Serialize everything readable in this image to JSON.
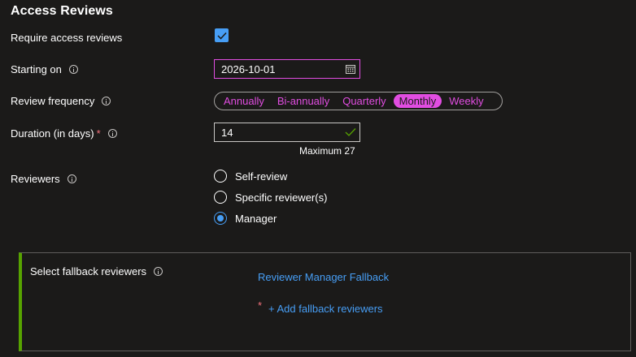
{
  "section_title": "Access Reviews",
  "require": {
    "label": "Require access reviews",
    "checked": true
  },
  "starting_on": {
    "label": "Starting on",
    "value": "2026-10-01"
  },
  "frequency": {
    "label": "Review frequency",
    "options": [
      "Annually",
      "Bi-annually",
      "Quarterly",
      "Monthly",
      "Weekly"
    ],
    "selected": "Monthly"
  },
  "duration": {
    "label": "Duration (in days)",
    "required_mark": "*",
    "value": "14",
    "hint": "Maximum 27"
  },
  "reviewers": {
    "label": "Reviewers",
    "options": [
      "Self-review",
      "Specific reviewer(s)",
      "Manager"
    ],
    "selected": "Manager"
  },
  "fallback": {
    "label": "Select fallback reviewers",
    "value_link": "Reviewer Manager Fallback",
    "required_mark": "*",
    "add_link": "+ Add fallback reviewers"
  },
  "colors": {
    "accent_magenta": "#e14de1",
    "accent_blue": "#479ef5",
    "success_green": "#57a300",
    "background": "#1b1a19"
  }
}
